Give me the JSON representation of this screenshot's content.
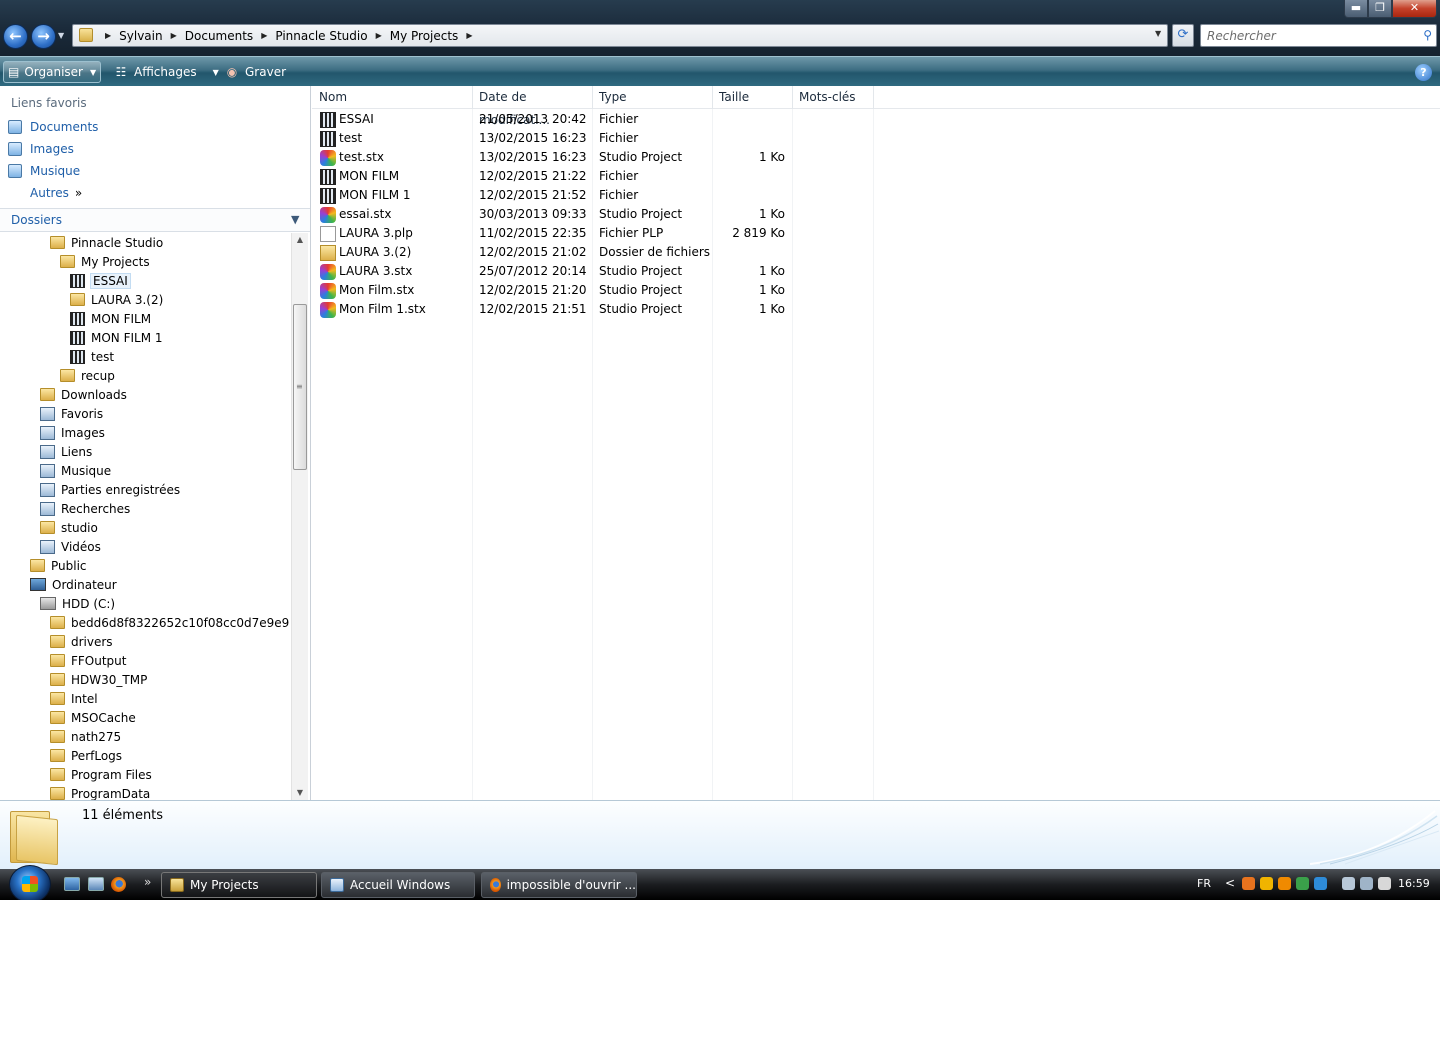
{
  "window": {
    "controls": {
      "minimize": "▬",
      "maximize": "❐",
      "close": "✕"
    }
  },
  "nav": {
    "back_glyph": "←",
    "forward_glyph": "→",
    "breadcrumb": [
      "Sylvain",
      "Documents",
      "Pinnacle Studio",
      "My Projects"
    ],
    "search_placeholder": "Rechercher"
  },
  "toolbar": {
    "organiser": "Organiser",
    "affichages": "Affichages",
    "graver": "Graver",
    "help": "?"
  },
  "favorites": {
    "title": "Liens favoris",
    "items": [
      {
        "label": "Documents",
        "icon": "documents-icon"
      },
      {
        "label": "Images",
        "icon": "images-icon"
      },
      {
        "label": "Musique",
        "icon": "music-icon"
      }
    ],
    "more": "Autres",
    "more_glyph": "»"
  },
  "folders": {
    "title": "Dossiers",
    "tree": [
      {
        "label": "Pinnacle Studio",
        "indent": 3,
        "icon": "folder"
      },
      {
        "label": "My Projects",
        "indent": 4,
        "icon": "folder"
      },
      {
        "label": "ESSAI",
        "indent": 5,
        "icon": "film",
        "selected": true
      },
      {
        "label": "LAURA 3.(2)",
        "indent": 5,
        "icon": "folder"
      },
      {
        "label": "MON FILM",
        "indent": 5,
        "icon": "film"
      },
      {
        "label": "MON FILM 1",
        "indent": 5,
        "icon": "film"
      },
      {
        "label": "test",
        "indent": 5,
        "icon": "film"
      },
      {
        "label": "recup",
        "indent": 4,
        "icon": "folder"
      },
      {
        "label": "Downloads",
        "indent": 2,
        "icon": "folder"
      },
      {
        "label": "Favoris",
        "indent": 2,
        "icon": "special"
      },
      {
        "label": "Images",
        "indent": 2,
        "icon": "special"
      },
      {
        "label": "Liens",
        "indent": 2,
        "icon": "special"
      },
      {
        "label": "Musique",
        "indent": 2,
        "icon": "special"
      },
      {
        "label": "Parties enregistrées",
        "indent": 2,
        "icon": "special"
      },
      {
        "label": "Recherches",
        "indent": 2,
        "icon": "special"
      },
      {
        "label": "studio",
        "indent": 2,
        "icon": "folder"
      },
      {
        "label": "Vidéos",
        "indent": 2,
        "icon": "special"
      },
      {
        "label": "Public",
        "indent": 1,
        "icon": "folder"
      },
      {
        "label": "Ordinateur",
        "indent": 1,
        "icon": "computer"
      },
      {
        "label": "HDD (C:)",
        "indent": 2,
        "icon": "drive"
      },
      {
        "label": "bedd6d8f8322652c10f08cc0d7e9e9",
        "indent": 3,
        "icon": "folder"
      },
      {
        "label": "drivers",
        "indent": 3,
        "icon": "folder"
      },
      {
        "label": "FFOutput",
        "indent": 3,
        "icon": "folder"
      },
      {
        "label": "HDW30_TMP",
        "indent": 3,
        "icon": "folder"
      },
      {
        "label": "Intel",
        "indent": 3,
        "icon": "folder"
      },
      {
        "label": "MSOCache",
        "indent": 3,
        "icon": "folder"
      },
      {
        "label": "nath275",
        "indent": 3,
        "icon": "folder"
      },
      {
        "label": "PerfLogs",
        "indent": 3,
        "icon": "folder"
      },
      {
        "label": "Program Files",
        "indent": 3,
        "icon": "folder"
      },
      {
        "label": "ProgramData",
        "indent": 3,
        "icon": "folder"
      }
    ]
  },
  "filelist": {
    "columns": [
      "Nom",
      "Date de modificati...",
      "Type",
      "Taille",
      "Mots-clés"
    ],
    "rows": [
      {
        "name": "ESSAI",
        "date": "21/05/2013 20:42",
        "type": "Fichier",
        "size": "",
        "icon": "film"
      },
      {
        "name": "test",
        "date": "13/02/2015 16:23",
        "type": "Fichier",
        "size": "",
        "icon": "film"
      },
      {
        "name": "test.stx",
        "date": "13/02/2015 16:23",
        "type": "Studio Project",
        "size": "1 Ko",
        "icon": "stx"
      },
      {
        "name": "MON FILM",
        "date": "12/02/2015 21:22",
        "type": "Fichier",
        "size": "",
        "icon": "film"
      },
      {
        "name": "MON FILM 1",
        "date": "12/02/2015 21:52",
        "type": "Fichier",
        "size": "",
        "icon": "film"
      },
      {
        "name": "essai.stx",
        "date": "30/03/2013 09:33",
        "type": "Studio Project",
        "size": "1 Ko",
        "icon": "stx"
      },
      {
        "name": "LAURA 3.plp",
        "date": "11/02/2015 22:35",
        "type": "Fichier PLP",
        "size": "2 819 Ko",
        "icon": "plp"
      },
      {
        "name": "LAURA 3.(2)",
        "date": "12/02/2015 21:02",
        "type": "Dossier de fichiers",
        "size": "",
        "icon": "folder"
      },
      {
        "name": "LAURA 3.stx",
        "date": "25/07/2012 20:14",
        "type": "Studio Project",
        "size": "1 Ko",
        "icon": "stx"
      },
      {
        "name": "Mon Film.stx",
        "date": "12/02/2015 21:20",
        "type": "Studio Project",
        "size": "1 Ko",
        "icon": "stx"
      },
      {
        "name": "Mon Film 1.stx",
        "date": "12/02/2015 21:51",
        "type": "Studio Project",
        "size": "1 Ko",
        "icon": "stx"
      }
    ]
  },
  "details": {
    "count": "11 éléments"
  },
  "taskbar": {
    "more_glyph": "»",
    "tasks": [
      {
        "label": "My Projects",
        "icon": "explorer",
        "active": true
      },
      {
        "label": "Accueil Windows",
        "icon": "doc",
        "active": false
      },
      {
        "label": "impossible d'ouvrir ...",
        "icon": "ff",
        "active": false
      }
    ],
    "language": "FR",
    "tray_chevron": "<",
    "clock": "16:59",
    "tray_colors": [
      "#e8731e",
      "#f0b400",
      "#f08a00",
      "#3aa04a",
      "#2e8bd8",
      "#b8c8d8",
      "#9fb4c8",
      "#d8d8d8",
      "#e8e8e8"
    ]
  }
}
